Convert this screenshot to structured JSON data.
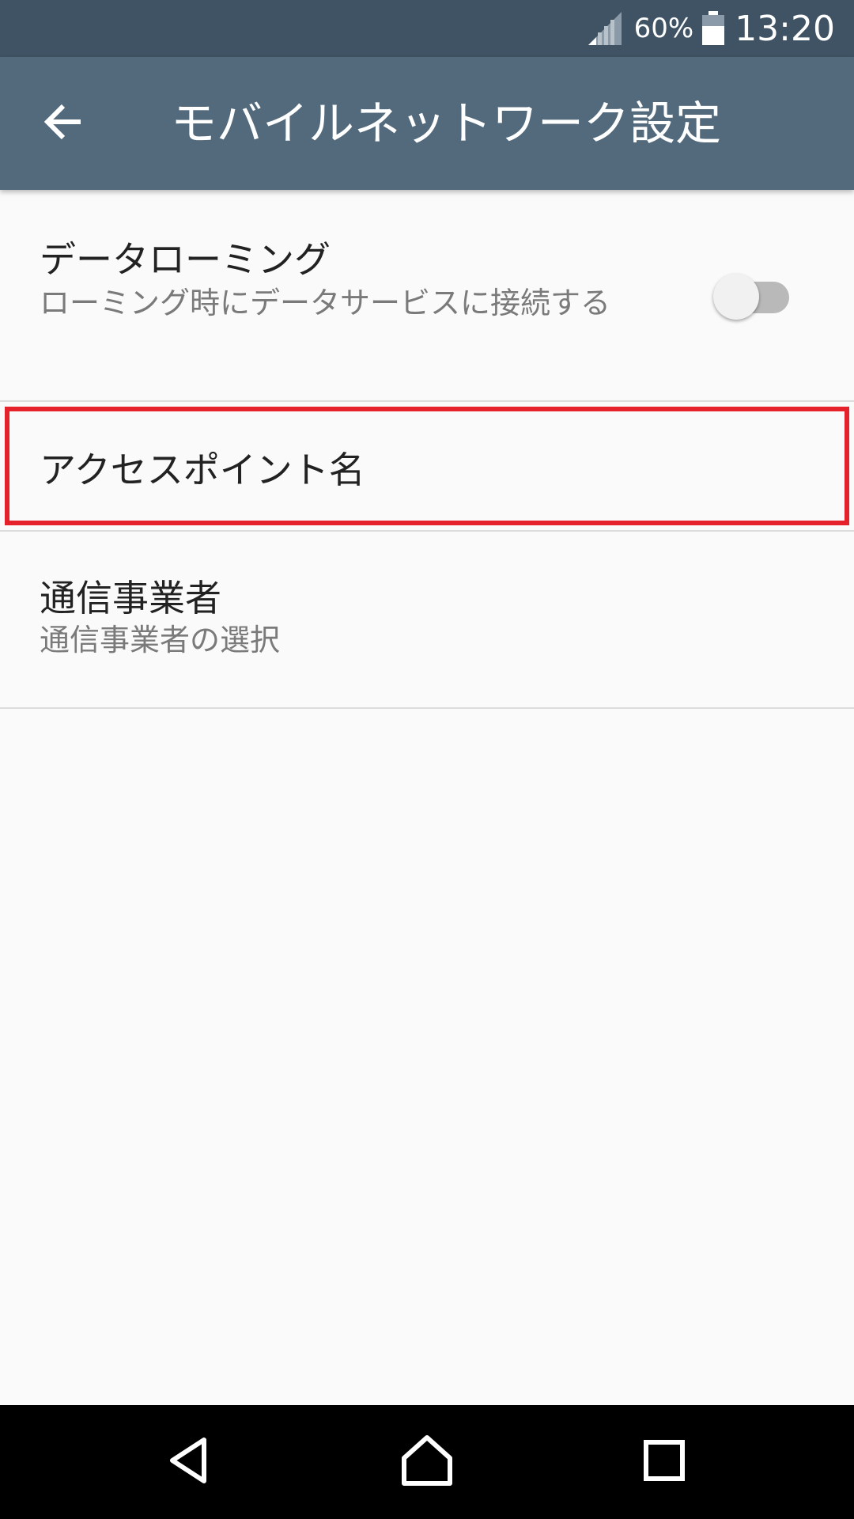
{
  "status_bar": {
    "battery_percent": "60%",
    "time": "13:20",
    "icons": [
      "signal-icon",
      "battery-icon"
    ]
  },
  "app_bar": {
    "title": "モバイルネットワーク設定",
    "back_icon": "arrow-back-icon"
  },
  "settings": {
    "data_roaming": {
      "title": "データローミング",
      "summary": "ローミング時にデータサービスに接続する",
      "toggle_on": false
    },
    "access_point_names": {
      "title": "アクセスポイント名",
      "highlight_color": "#e5222c"
    },
    "network_operators": {
      "title": "通信事業者",
      "summary": "通信事業者の選択"
    }
  },
  "nav_bar": {
    "icons": [
      "nav-back-icon",
      "nav-home-icon",
      "nav-recents-icon"
    ]
  },
  "colors": {
    "status_bar": "#3f5364",
    "app_bar": "#536a7d",
    "background": "#fafafa"
  }
}
